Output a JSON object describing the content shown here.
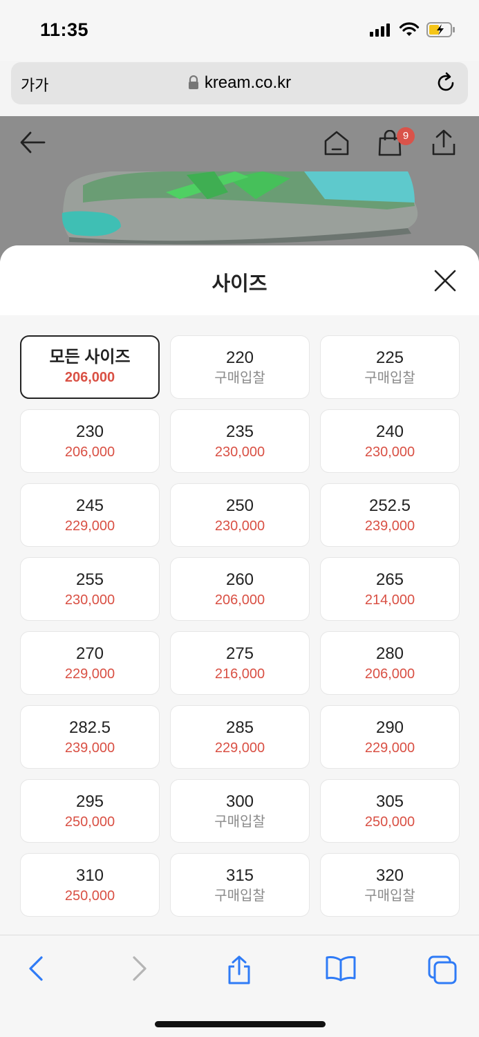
{
  "status": {
    "time": "11:35"
  },
  "browser": {
    "text_size_label": "가가",
    "url": "kream.co.kr"
  },
  "header": {
    "cart_count": "9"
  },
  "sheet": {
    "title": "사이즈"
  },
  "sizes": [
    {
      "size": "모든 사이즈",
      "price": "206,000",
      "is_bid": false,
      "selected": true
    },
    {
      "size": "220",
      "price": "구매입찰",
      "is_bid": true
    },
    {
      "size": "225",
      "price": "구매입찰",
      "is_bid": true
    },
    {
      "size": "230",
      "price": "206,000",
      "is_bid": false
    },
    {
      "size": "235",
      "price": "230,000",
      "is_bid": false
    },
    {
      "size": "240",
      "price": "230,000",
      "is_bid": false
    },
    {
      "size": "245",
      "price": "229,000",
      "is_bid": false
    },
    {
      "size": "250",
      "price": "230,000",
      "is_bid": false
    },
    {
      "size": "252.5",
      "price": "239,000",
      "is_bid": false
    },
    {
      "size": "255",
      "price": "230,000",
      "is_bid": false
    },
    {
      "size": "260",
      "price": "206,000",
      "is_bid": false
    },
    {
      "size": "265",
      "price": "214,000",
      "is_bid": false
    },
    {
      "size": "270",
      "price": "229,000",
      "is_bid": false
    },
    {
      "size": "275",
      "price": "216,000",
      "is_bid": false
    },
    {
      "size": "280",
      "price": "206,000",
      "is_bid": false
    },
    {
      "size": "282.5",
      "price": "239,000",
      "is_bid": false
    },
    {
      "size": "285",
      "price": "229,000",
      "is_bid": false
    },
    {
      "size": "290",
      "price": "229,000",
      "is_bid": false
    },
    {
      "size": "295",
      "price": "250,000",
      "is_bid": false
    },
    {
      "size": "300",
      "price": "구매입찰",
      "is_bid": true
    },
    {
      "size": "305",
      "price": "250,000",
      "is_bid": false
    },
    {
      "size": "310",
      "price": "250,000",
      "is_bid": false
    },
    {
      "size": "315",
      "price": "구매입찰",
      "is_bid": true
    },
    {
      "size": "320",
      "price": "구매입찰",
      "is_bid": true
    }
  ],
  "colors": {
    "price_red": "#d95044",
    "bid_gray": "#8a8a8a",
    "ios_blue": "#2f7bf6"
  },
  "icons": {
    "back": "arrow-left-icon",
    "home": "home-icon",
    "cart": "shopping-bag-icon",
    "share": "share-icon",
    "close": "close-icon",
    "lock": "lock-icon",
    "reload": "reload-icon"
  }
}
